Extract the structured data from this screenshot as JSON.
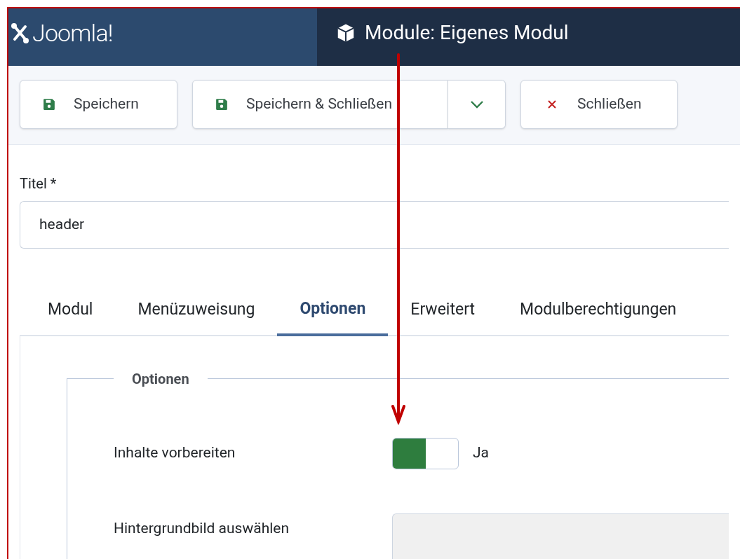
{
  "header": {
    "logo": "Joomla!",
    "title": "Module: Eigenes Modul"
  },
  "toolbar": [
    {
      "kind": "save",
      "label": "Speichern"
    },
    {
      "kind": "save-split",
      "label": "Speichern & Schließen"
    },
    {
      "kind": "close",
      "label": "Schließen"
    }
  ],
  "title_field": {
    "label": "Titel *",
    "value": "header"
  },
  "tabs": [
    {
      "label": "Modul",
      "selected": false
    },
    {
      "label": "Menüzuweisung",
      "selected": false
    },
    {
      "label": "Optionen",
      "selected": true
    },
    {
      "label": "Erweitert",
      "selected": false
    },
    {
      "label": "Modulberechtigungen",
      "selected": false
    }
  ],
  "fieldset": {
    "legend": "Optionen",
    "rows": [
      {
        "kind": "toggle",
        "label": "Inhalte vorbereiten",
        "on": true,
        "value_text": "Ja"
      },
      {
        "kind": "field",
        "label": "Hintergrundbild auswählen"
      }
    ]
  }
}
